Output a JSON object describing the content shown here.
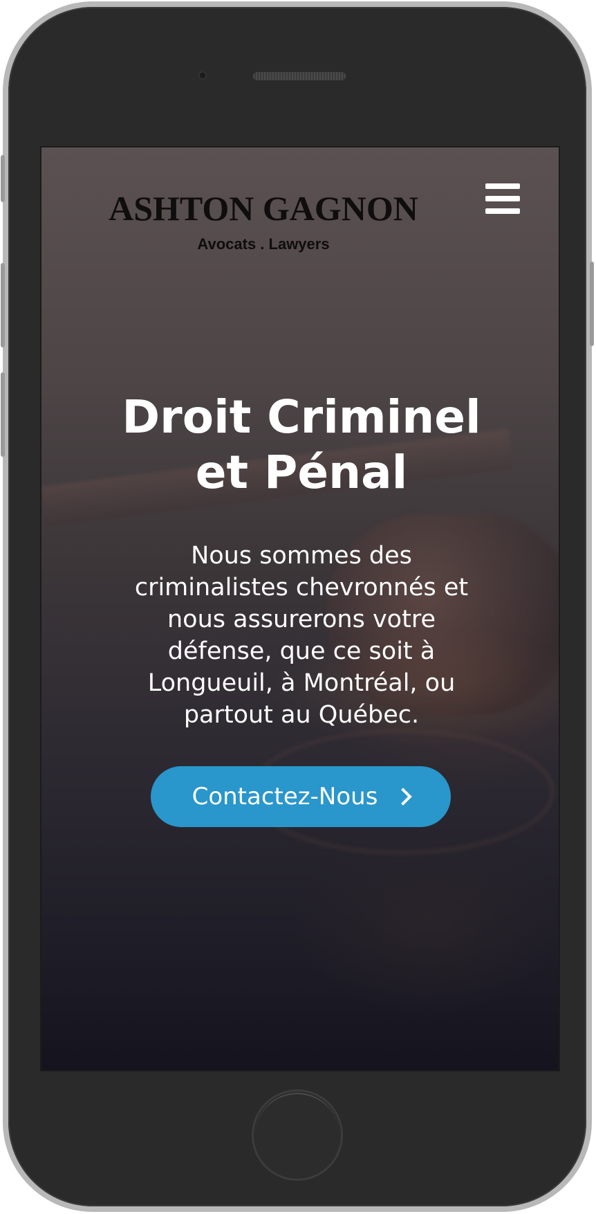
{
  "header": {
    "brand_name": "ASHTON GAGNON",
    "tagline": "Avocats . Lawyers",
    "menu_icon": "hamburger-menu-icon"
  },
  "hero": {
    "title": "Droit Criminel et Pénal",
    "description": "Nous sommes des criminalistes chevronnés et nous assurerons votre défense, que ce soit à Longueuil, à Montréal, ou partout au Québec.",
    "cta_label": "Contactez-Nous",
    "cta_icon": "chevron-right-icon"
  },
  "colors": {
    "accent": "#2996cc",
    "hero_text": "#ffffff",
    "brand_text": "#0f0d0d",
    "device_frame": "#2a2a2a"
  }
}
